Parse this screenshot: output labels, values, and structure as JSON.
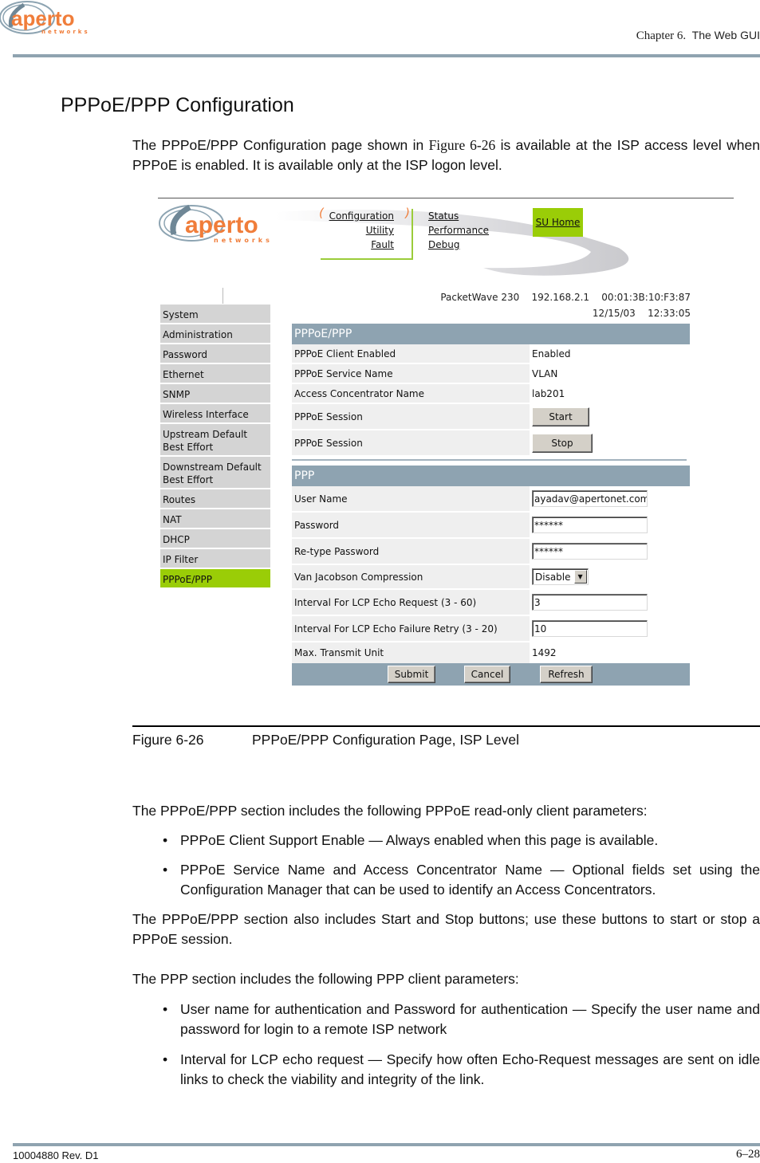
{
  "document": {
    "chapter_label": "Chapter 6.",
    "chapter_title": "The Web GUI",
    "logo_text": "aperto",
    "logo_subtext": "networks",
    "section_title": "PPPoE/PPP Configuration",
    "intro": {
      "before_ref": "The PPPoE/PPP Configuration page shown in ",
      "ref": "Figure 6-26",
      "after_ref": " is available at the ISP access level when PPPoE is enabled. It is available only at the ISP logon level."
    },
    "caption": {
      "number": "Figure 6-26",
      "text": "PPPoE/PPP Configuration Page, ISP Level"
    },
    "body": {
      "p1": "The PPPoE/PPP section includes the following PPPoE read-only client parameters:",
      "p1_bullets": [
        "PPPoE  Client Support Enable — Always enabled when this page is available.",
        "PPPoE Service Name and Access Concentrator Name — Optional fields set using the Configuration Manager that can be used to identify an Access Concentrators."
      ],
      "p2": "The PPPoE/PPP section also includes Start and Stop buttons; use these buttons to start or stop a PPPoE session.",
      "p3": "The PPP section includes the following PPP client parameters:",
      "p3_bullets": [
        "User name for authentication and Password for authentication — Specify the user name and password for login to a remote ISP network",
        "Interval for LCP echo request — Specify how often Echo-Request messages are sent on idle links to check the viability and integrity of the link."
      ]
    },
    "footer": {
      "doc_id": "10004880 Rev. D1",
      "page": "6–28"
    }
  },
  "screenshot": {
    "logo_text": "aperto",
    "logo_subtext": "networks",
    "nav": {
      "group1": [
        "Configuration",
        "Utility",
        "Fault"
      ],
      "group2": [
        "Status",
        "Performance",
        "Debug"
      ],
      "home": "SU Home"
    },
    "device": {
      "model": "PacketWave 230",
      "ip": "192.168.2.1",
      "mac": "00:01:3B:10:F3:87",
      "date": "12/15/03",
      "time": "12:33:05"
    },
    "sidebar": {
      "items": [
        {
          "label": "System"
        },
        {
          "label": "Administration"
        },
        {
          "label": "Password"
        },
        {
          "label": "Ethernet"
        },
        {
          "label": "SNMP"
        },
        {
          "label": "Wireless Interface"
        },
        {
          "label": "Upstream Default Best Effort"
        },
        {
          "label": "Downstream Default Best Effort"
        },
        {
          "label": "Routes"
        },
        {
          "label": "NAT"
        },
        {
          "label": "DHCP"
        },
        {
          "label": "IP Filter"
        },
        {
          "label": "PPPoE/PPP",
          "active": true
        }
      ]
    },
    "pppoe": {
      "header": "PPPoE/PPP",
      "client_enabled": {
        "label": "PPPoE Client Enabled",
        "value": "Enabled"
      },
      "service_name": {
        "label": "PPPoE Service Name",
        "value": "VLAN"
      },
      "ac_name": {
        "label": "Access Concentrator Name",
        "value": "lab201"
      },
      "session_start": {
        "label": "PPPoE Session",
        "button": "Start"
      },
      "session_stop": {
        "label": "PPPoE Session",
        "button": "Stop"
      }
    },
    "ppp": {
      "header": "PPP",
      "user_name": {
        "label": "User Name",
        "value": "ayadav@apertonet.com"
      },
      "password": {
        "label": "Password",
        "value": "******"
      },
      "retype_password": {
        "label": "Re-type Password",
        "value": "******"
      },
      "vj_compression": {
        "label": "Van Jacobson Compression",
        "value": "Disable"
      },
      "lcp_echo_request": {
        "label": "Interval For LCP Echo Request (3 - 60)",
        "value": "3"
      },
      "lcp_echo_failure": {
        "label": "Interval For LCP Echo Failure Retry (3 - 20)",
        "value": "10"
      },
      "mtu": {
        "label": "Max. Transmit Unit",
        "value": "1492"
      }
    },
    "buttons": {
      "submit": "Submit",
      "cancel": "Cancel",
      "refresh": "Refresh"
    },
    "colors": {
      "accent_green": "#9acd07",
      "header_blue_gray": "#8ea3b1",
      "logo_orange": "#f07d3a"
    }
  }
}
